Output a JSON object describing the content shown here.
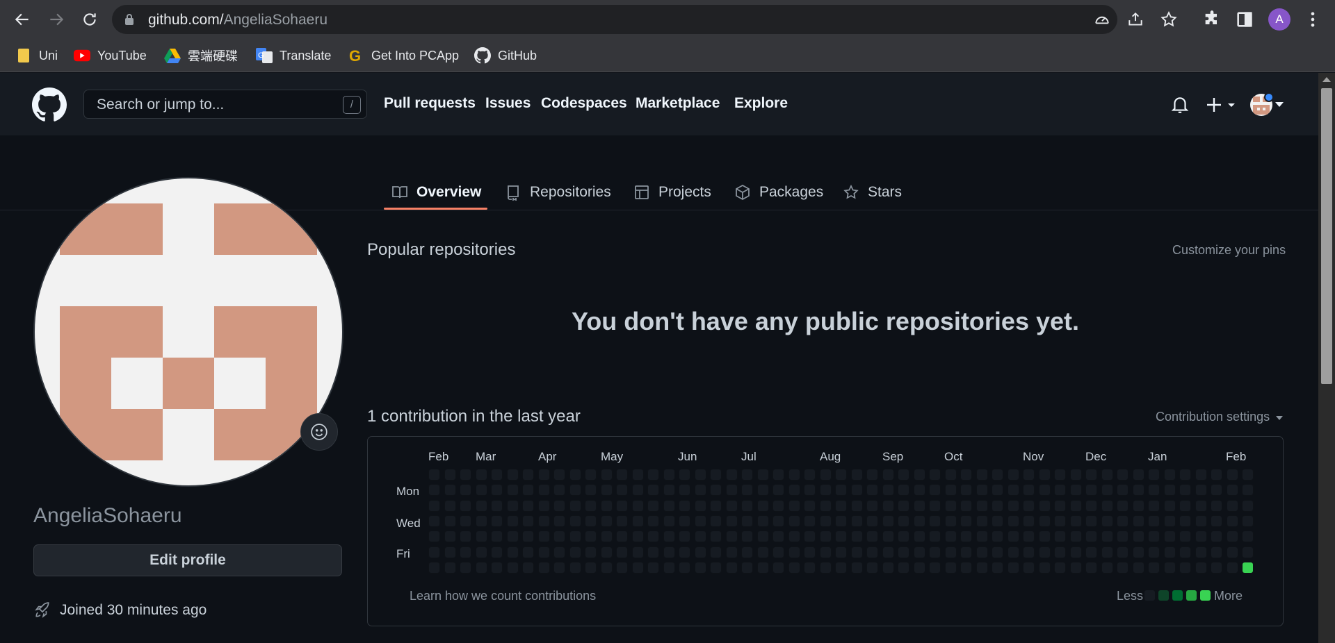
{
  "browser": {
    "url_domain": "github.com/",
    "url_path": "AngeliaSohaeru",
    "profile_initial": "A",
    "bookmarks": [
      {
        "label": "Uni",
        "icon": "folder-icon"
      },
      {
        "label": "YouTube",
        "icon": "youtube-icon"
      },
      {
        "label": "雲端硬碟",
        "icon": "google-drive-icon"
      },
      {
        "label": "Translate",
        "icon": "google-translate-icon"
      },
      {
        "label": "Get Into PCApp",
        "icon": "getintopc-icon"
      },
      {
        "label": "GitHub",
        "icon": "github-icon"
      }
    ]
  },
  "header": {
    "search_placeholder": "Search or jump to...",
    "search_shortcut": "/",
    "nav": [
      "Pull requests",
      "Issues",
      "Codespaces",
      "Marketplace",
      "Explore"
    ]
  },
  "tabs": [
    {
      "label": "Overview",
      "icon": "book-icon",
      "selected": true
    },
    {
      "label": "Repositories",
      "icon": "repo-icon",
      "selected": false
    },
    {
      "label": "Projects",
      "icon": "table-icon",
      "selected": false
    },
    {
      "label": "Packages",
      "icon": "package-icon",
      "selected": false
    },
    {
      "label": "Stars",
      "icon": "star-icon",
      "selected": false
    }
  ],
  "profile": {
    "username": "AngeliaSohaeru",
    "edit_label": "Edit profile",
    "joined": "Joined 30 minutes ago",
    "avatar_color": "#d29881"
  },
  "popular": {
    "title": "Popular repositories",
    "customize": "Customize your pins",
    "empty": "You don't have any public repositories yet."
  },
  "contributions": {
    "title": "1 contribution in the last year",
    "settings": "Contribution settings",
    "months": [
      "Feb",
      "Mar",
      "Apr",
      "May",
      "Jun",
      "Jul",
      "Aug",
      "Sep",
      "Oct",
      "Nov",
      "Dec",
      "Jan",
      "Feb"
    ],
    "days": [
      "Mon",
      "Wed",
      "Fri"
    ],
    "learn": "Learn how we count contributions",
    "less": "Less",
    "more": "More",
    "weeks": 53,
    "active_cell": {
      "week": 52,
      "day": 6
    },
    "colors": {
      "empty": "#161b22",
      "levels": [
        "#161b22",
        "#0e4429",
        "#006d32",
        "#26a641",
        "#39d353"
      ]
    }
  }
}
